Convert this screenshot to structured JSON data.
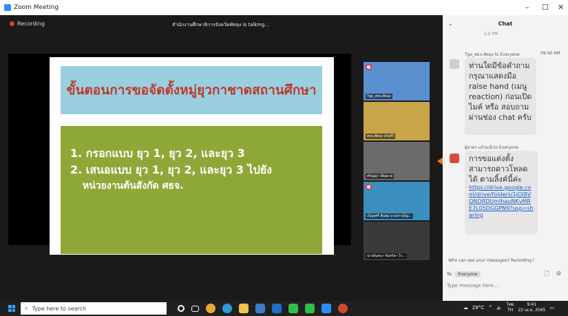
{
  "window": {
    "title": "Zoom Meeting",
    "minimize": "–",
    "maximize": "☐",
    "close": "✕"
  },
  "meeting": {
    "recording_label": "Recording",
    "talking_text": "สำนักงานศึกษาธิการจังหวัดพัทลุง is talking...",
    "slide": {
      "heading": "ขั้นตอนการขอจัดตั้งหมู่ยุวกาชาดสถานศึกษา",
      "line1": "1. กรอกแบบ ยุว 1, ยุว 2, และยุว 3",
      "line2": "2. เสนอแบบ ยุว 1, ยุว 2, และยุว 3 ไปยัง",
      "line3": "หน่วยงานต้นสังกัด ศธจ."
    },
    "thumbnails": [
      {
        "name": "Tgo_ศธจ.พัทลุง",
        "color": "#5a8fd0"
      },
      {
        "name": "ศธจ.พัทลุง (staff)",
        "color": "#c9a54a"
      },
      {
        "name": "ศรัญญา เพ็ญนวล",
        "color": "#6b6b6b"
      },
      {
        "name": "เบ็ญจศรี สินสม นางสาวเบ็ญ...",
        "color": "#3a8fbe"
      },
      {
        "name": "นางจันทนา จันทร์ลา โร...",
        "color": "#3a3a3a"
      }
    ],
    "arrow_color": "#f07d1a"
  },
  "chat": {
    "title": "Chat",
    "collapse_icon": "chevron-down-icon",
    "top_time": "2:0 PM",
    "message1": {
      "sender": "Tgo_ศธจ.พัทลุง to Everyone",
      "time": "09:40 AM",
      "text": "ท่านใดมีข้อคำถาม กรุณาแสดงมือ raise hand (เมนู reaction) ก่อนเปิดไมค์ หรือ สอบถามผ่านช่อง chat ครับ"
    },
    "message2": {
      "sender": "ผู้อาคร แก้วมณี to Everyone",
      "text": "การขอแต่งตั้ง สามารถดาวโหลดได้ ตามลิ้งค์นี้ค่ะ",
      "link": "https://drive.google.com/drive/folders/1JOI8VQNORDUmIhauNKvMRE7L05DGGPN9?usp=sharing"
    },
    "who_can_see": "Who can see your messages? Recording (",
    "to_label": "To:",
    "to_value": "Everyone",
    "input_placeholder": "Type message here..."
  },
  "taskbar": {
    "search_placeholder": "Type here to search",
    "temperature": "29°C",
    "lang_top": "ไทย",
    "lang_bottom": "TH",
    "time": "9:41",
    "date": "22 เม.ย. 2565",
    "apps": [
      "cortana",
      "task-view",
      "chrome",
      "edge",
      "file-explorer",
      "store",
      "mail",
      "line",
      "line2",
      "zoom",
      "powerpoint"
    ]
  }
}
